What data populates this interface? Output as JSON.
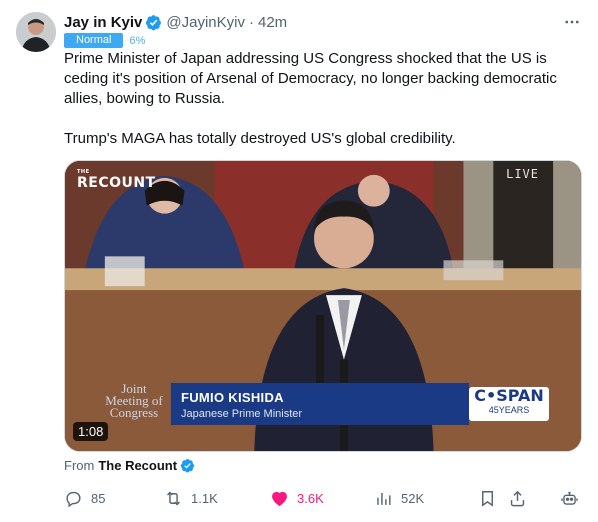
{
  "author": {
    "name": "Jay in Kyiv",
    "handle": "@JayinKyiv",
    "separator": "·",
    "time": "42m"
  },
  "tone_tag": {
    "label": "Normal",
    "percent": "6%"
  },
  "tweet": {
    "paragraphs": [
      "Prime Minister of Japan addressing US Congress shocked that the US is ceding it's position of Arsenal of Democracy, no longer backing democratic allies, bowing to Russia.",
      "Trump's MAGA has totally destroyed US's global credibility."
    ]
  },
  "video": {
    "brand_small": "THE",
    "brand": "RECOUNT",
    "live_label": "LIVE",
    "joint_meeting": [
      "Joint",
      "Meeting of",
      "Congress"
    ],
    "speaker_name": "FUMIO KISHIDA",
    "speaker_title": "Japanese Prime Minister",
    "network": "C•SPAN",
    "network_sub": "45YEARS",
    "duration": "1:08"
  },
  "source": {
    "prefix": "From",
    "name": "The Recount"
  },
  "actions": {
    "replies": "85",
    "reposts": "1.1K",
    "likes": "3.6K",
    "views": "52K"
  },
  "colors": {
    "accent": "#1d9bf0",
    "like": "#f91880",
    "muted": "#536471",
    "cspan_blue": "#1b3a85"
  }
}
